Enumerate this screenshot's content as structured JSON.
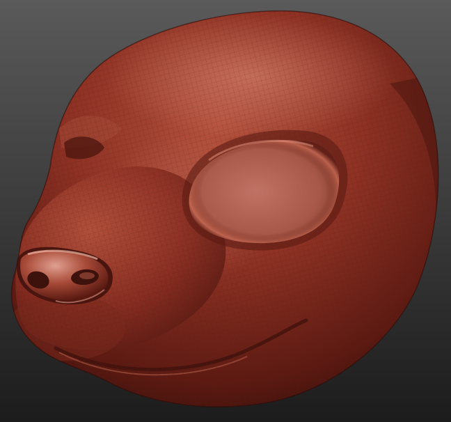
{
  "scene": {
    "subject": "sculpted-head-model",
    "colors": {
      "background_top": "#5a5a5a",
      "background_bottom": "#1c1c1c",
      "clay_base": "#8a2f22",
      "clay_light": "#c2604a",
      "clay_highlight": "#e0907c",
      "clay_shadow": "#3e120c",
      "wire": "#5a1a12"
    }
  }
}
